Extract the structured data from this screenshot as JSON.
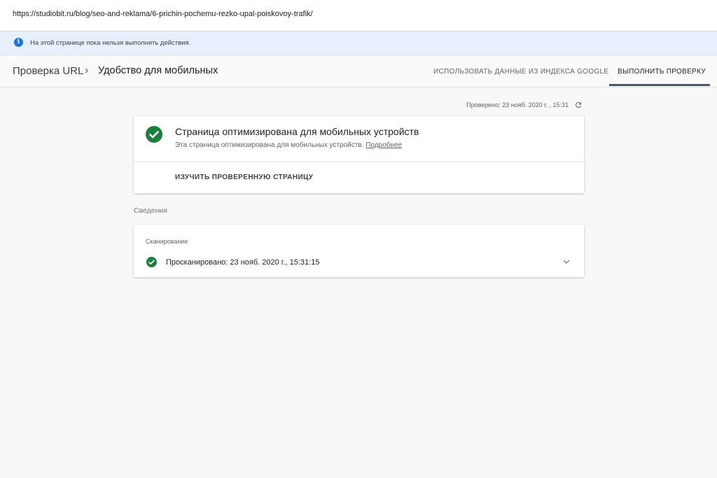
{
  "browser": {
    "url": "https://studiobit.ru/blog/seo-and-reklama/6-prichin-pochemu-rezko-upal-poiskovoy-trafik/"
  },
  "info_banner": {
    "icon": "info-icon",
    "text": "На этой странице пока нельзя выполнять действия."
  },
  "header": {
    "breadcrumb_root": "Проверка URL",
    "breadcrumb_sep": "›",
    "breadcrumb_current": "Удобство для мобильных",
    "tabs": [
      {
        "label": "ИСПОЛЬЗОВАТЬ ДАННЫЕ ИЗ ИНДЕКСА GOOGLE",
        "active": false
      },
      {
        "label": "ВЫПОЛНИТЬ ПРОВЕРКУ",
        "active": true
      }
    ]
  },
  "status": {
    "checked_text": "Проверено: 23 нояб. 2020 г. , 15:31",
    "refresh_icon": "refresh-icon"
  },
  "result_card": {
    "title": "Страница оптимизирована для мобильных устройств",
    "subtitle": "Эта страница оптимизирована для мобильных устройств.",
    "link": "Подробнее",
    "button": "ИЗУЧИТЬ ПРОВЕРЕННУЮ СТРАНИЦУ",
    "icon": "check-circle-icon"
  },
  "details": {
    "section_label": "Сведения",
    "crawl_heading": "Сканирование",
    "crawl_status": "Просканировано: 23 нояб. 2020 г., 15:31:15"
  },
  "colors": {
    "success_green": "#188038",
    "accent_dark": "#455a64",
    "info_blue": "#1a73e8",
    "banner_bg": "#e8f1fb"
  }
}
